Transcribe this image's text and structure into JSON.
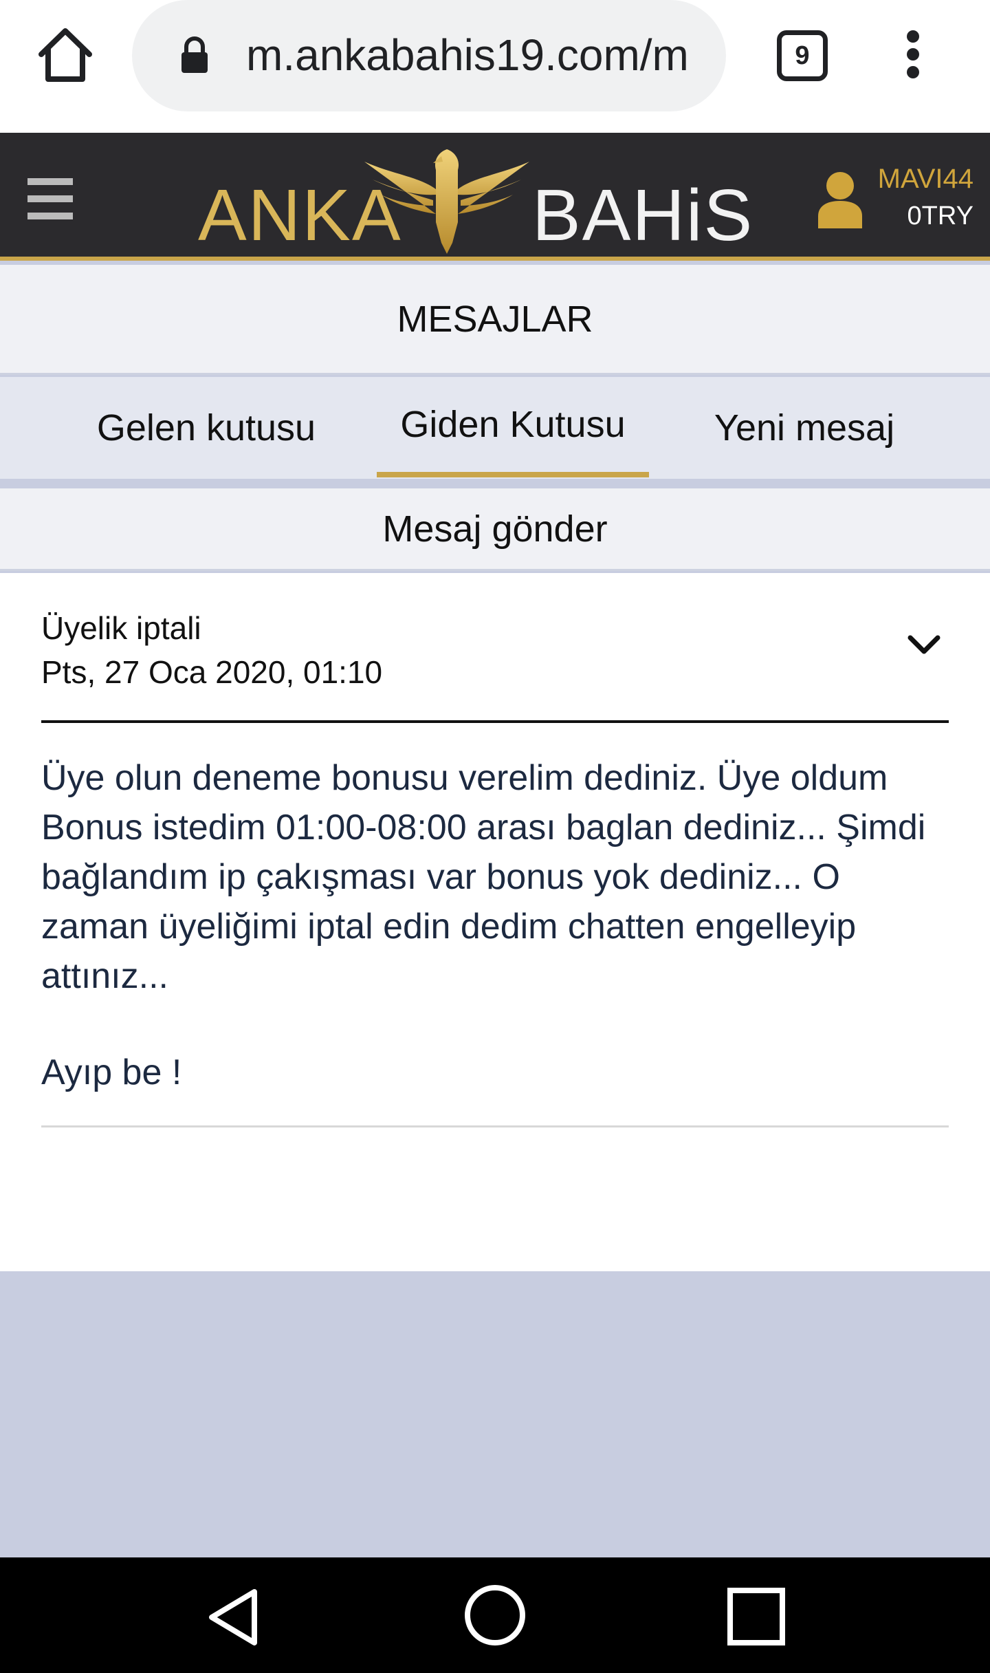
{
  "browser": {
    "url": "m.ankabahis19.com/m",
    "tab_count": "9"
  },
  "header": {
    "logo_left": "ANKA",
    "logo_right": "BAHiS",
    "username": "MAVI44",
    "balance": "0TRY",
    "accent_color": "#c9a54a"
  },
  "page": {
    "title": "MESAJLAR"
  },
  "tabs": [
    {
      "label": "Gelen kutusu",
      "active": false
    },
    {
      "label": "Giden Kutusu",
      "active": true
    },
    {
      "label": "Yeni mesaj",
      "active": false
    }
  ],
  "send_bar": {
    "label": "Mesaj gönder"
  },
  "message": {
    "subject": "Üyelik iptali",
    "date": "Pts, 27 Oca 2020, 01:10",
    "body": "Üye olun deneme bonusu verelim dediniz. Üye oldum Bonus istedim 01:00-08:00 arası baglan dediniz... Şimdi bağlandım ip çakışması var bonus yok dediniz... O zaman üyeliğimi iptal edin dedim chatten engelleyip attınız...",
    "closing": "Ayıp be !"
  },
  "icons": {
    "home": "home-icon",
    "lock": "lock-icon",
    "menu": "more-vert-icon",
    "hamburger": "hamburger-icon",
    "user": "user-icon",
    "chevron": "chevron-down-icon"
  }
}
